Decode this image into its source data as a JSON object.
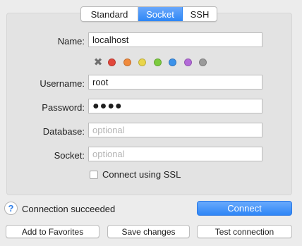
{
  "tabs": [
    {
      "label": "Standard",
      "active": false
    },
    {
      "label": "Socket",
      "active": true
    },
    {
      "label": "SSH",
      "active": false
    }
  ],
  "form": {
    "name_label": "Name:",
    "name_value": "localhost",
    "username_label": "Username:",
    "username_value": "root",
    "password_label": "Password:",
    "password_value": "●●●●",
    "database_label": "Database:",
    "database_placeholder": "optional",
    "socket_label": "Socket:",
    "socket_placeholder": "optional",
    "ssl_label": "Connect using SSL",
    "ssl_checked": false
  },
  "color_tags": {
    "clear_icon": "✖",
    "colors": [
      "#e2473b",
      "#f08a3c",
      "#e9d54a",
      "#7ccb3e",
      "#3c92ea",
      "#b36ad8",
      "#9a9a9a"
    ]
  },
  "status": {
    "help_icon": "?",
    "message": "Connection succeeded"
  },
  "buttons": {
    "connect": "Connect",
    "add_favorites": "Add to Favorites",
    "save_changes": "Save changes",
    "test_connection": "Test connection"
  },
  "accent": "#2d86f5"
}
